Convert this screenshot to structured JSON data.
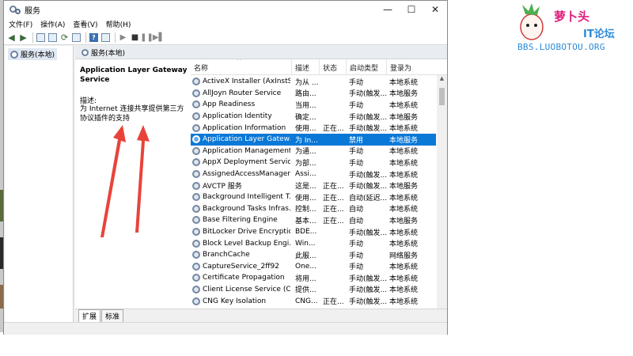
{
  "window": {
    "title": "服务",
    "minimize": "—",
    "maximize": "☐",
    "close": "✕"
  },
  "menu": [
    "文件(F)",
    "操作(A)",
    "查看(V)",
    "帮助(H)"
  ],
  "tree": {
    "root": "服务(本地)"
  },
  "content_header": "服务(本地)",
  "selected_service": {
    "title": "Application Layer Gateway Service",
    "desc_label": "描述:",
    "description": "为 Internet 连接共享提供第三方协议插件的支持"
  },
  "columns": {
    "name": "名称",
    "desc": "描述",
    "status": "状态",
    "startup": "启动类型",
    "login": "登录为",
    "sort_caret": "^"
  },
  "services": [
    {
      "name": "ActiveX Installer (AxInstSV)",
      "desc": "为从 ...",
      "status": "",
      "startup": "手动",
      "login": "本地系统"
    },
    {
      "name": "AllJoyn Router Service",
      "desc": "路由...",
      "status": "",
      "startup": "手动(触发...",
      "login": "本地服务"
    },
    {
      "name": "App Readiness",
      "desc": "当用...",
      "status": "",
      "startup": "手动",
      "login": "本地系统"
    },
    {
      "name": "Application Identity",
      "desc": "确定...",
      "status": "",
      "startup": "手动(触发...",
      "login": "本地服务"
    },
    {
      "name": "Application Information",
      "desc": "使用...",
      "status": "正在...",
      "startup": "手动(触发...",
      "login": "本地系统"
    },
    {
      "name": "Application Layer Gatewa...",
      "desc": "为 In...",
      "status": "",
      "startup": "禁用",
      "login": "本地服务"
    },
    {
      "name": "Application Management",
      "desc": "为通...",
      "status": "",
      "startup": "手动",
      "login": "本地系统"
    },
    {
      "name": "AppX Deployment Servic...",
      "desc": "为部...",
      "status": "",
      "startup": "手动",
      "login": "本地系统"
    },
    {
      "name": "AssignedAccessManager...",
      "desc": "Assi...",
      "status": "",
      "startup": "手动(触发...",
      "login": "本地系统"
    },
    {
      "name": "AVCTP 服务",
      "desc": "这是...",
      "status": "正在...",
      "startup": "手动(触发...",
      "login": "本地服务"
    },
    {
      "name": "Background Intelligent T...",
      "desc": "使用...",
      "status": "正在...",
      "startup": "自动(延迟...",
      "login": "本地系统"
    },
    {
      "name": "Background Tasks Infras...",
      "desc": "控制...",
      "status": "正在...",
      "startup": "自动",
      "login": "本地系统"
    },
    {
      "name": "Base Filtering Engine",
      "desc": "基本...",
      "status": "正在...",
      "startup": "自动",
      "login": "本地服务"
    },
    {
      "name": "BitLocker Drive Encryptio...",
      "desc": "BDE...",
      "status": "",
      "startup": "手动(触发...",
      "login": "本地系统"
    },
    {
      "name": "Block Level Backup Engi...",
      "desc": "Win...",
      "status": "",
      "startup": "手动",
      "login": "本地系统"
    },
    {
      "name": "BranchCache",
      "desc": "此服...",
      "status": "",
      "startup": "手动",
      "login": "网络服务"
    },
    {
      "name": "CaptureService_2ff92",
      "desc": "One...",
      "status": "",
      "startup": "手动",
      "login": "本地系统"
    },
    {
      "name": "Certificate Propagation",
      "desc": "将用...",
      "status": "",
      "startup": "手动(触发...",
      "login": "本地系统"
    },
    {
      "name": "Client License Service (Cli...",
      "desc": "提供...",
      "status": "",
      "startup": "手动(触发...",
      "login": "本地系统"
    },
    {
      "name": "CNG Key Isolation",
      "desc": "CNG...",
      "status": "正在...",
      "startup": "手动(触发...",
      "login": "本地系统"
    }
  ],
  "tabs": [
    "扩展",
    "标准"
  ],
  "watermark": {
    "name": "萝卜头",
    "it": "IT论坛",
    "url": "BBS.LUOBOTOU.ORG"
  },
  "colors": {
    "selection": "#0a78d7",
    "arrow": "#e8433b",
    "watermark_pink": "#e0197b",
    "watermark_blue": "#2a8ad9"
  }
}
